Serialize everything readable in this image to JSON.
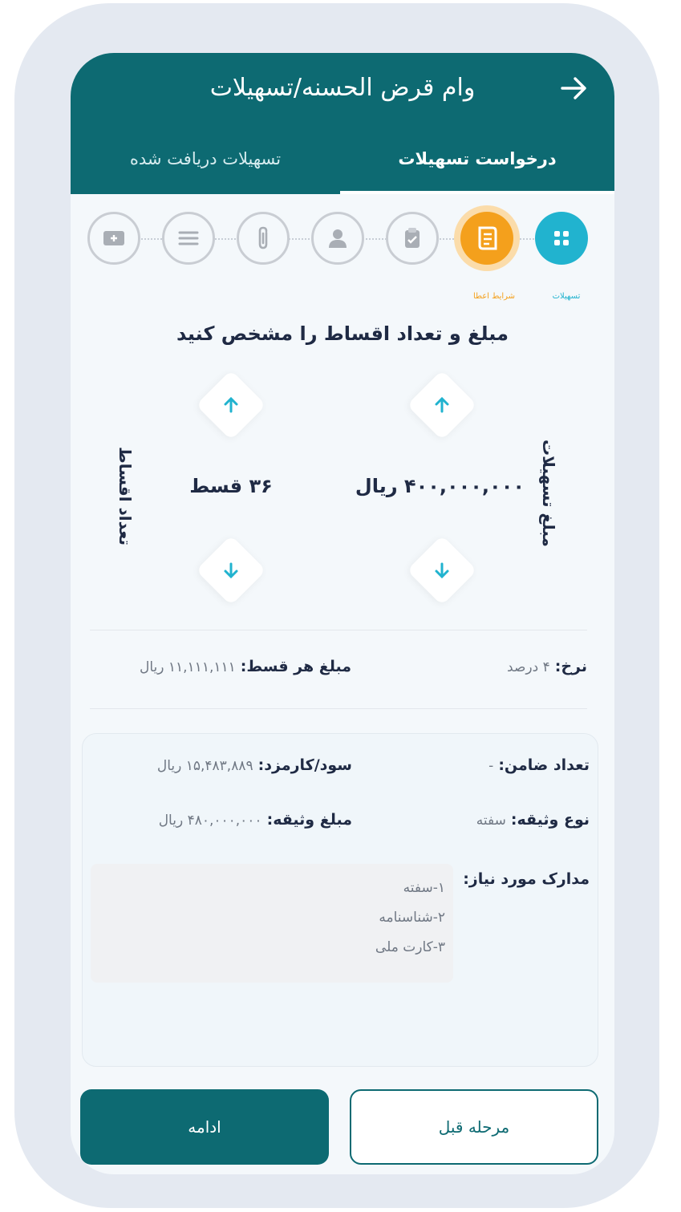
{
  "header": {
    "title": "وام قرض الحسنه/تسهیلات",
    "tabs": [
      "درخواست تسهیلات",
      "تسهیلات دریافت شده"
    ]
  },
  "steps": [
    {
      "icon": "grid-icon",
      "label": "تسهیلات",
      "state": "done"
    },
    {
      "icon": "scroll-icon",
      "label": "شرایط اعطا",
      "state": "active"
    },
    {
      "icon": "clipboard-icon",
      "label": "",
      "state": "inactive"
    },
    {
      "icon": "user-icon",
      "label": "",
      "state": "inactive"
    },
    {
      "icon": "paperclip-icon",
      "label": "",
      "state": "inactive"
    },
    {
      "icon": "list-icon",
      "label": "",
      "state": "inactive"
    },
    {
      "icon": "video-icon",
      "label": "",
      "state": "inactive"
    }
  ],
  "section_title": "مبلغ و تعداد اقساط را مشخص کنید",
  "amount": {
    "label": "مبلغ تسهیلات",
    "value": "۴۰۰,۰۰۰,۰۰۰ ریال"
  },
  "installments": {
    "label": "تعداد اقساط",
    "value": "۳۶ قسط"
  },
  "rate": {
    "label": "نرخ:",
    "value": "۴ درصد"
  },
  "installment_amount": {
    "label": "مبلغ هر قسط:",
    "value": "۱۱,۱۱۱,۱۱۱ ریال"
  },
  "details": {
    "guarantors": {
      "label": "تعداد ضامن:",
      "value": "-"
    },
    "profit": {
      "label": "سود/کارمزد:",
      "value": "۱۵,۴۸۳,۸۸۹ ریال"
    },
    "collateral_type": {
      "label": "نوع وثیقه:",
      "value": "سفته"
    },
    "collateral_amount": {
      "label": "مبلغ وثیقه:",
      "value": "۴۸۰,۰۰۰,۰۰۰ ریال"
    },
    "documents_label": "مدارک مورد نیاز:",
    "documents": [
      "۱-سفته",
      "۲-شناسنامه",
      "۳-کارت ملی"
    ]
  },
  "buttons": {
    "previous": "مرحله قبل",
    "continue": "ادامه"
  },
  "colors": {
    "primary": "#0d6a72",
    "accent": "#21b3cf",
    "active_step": "#f4a01c"
  }
}
